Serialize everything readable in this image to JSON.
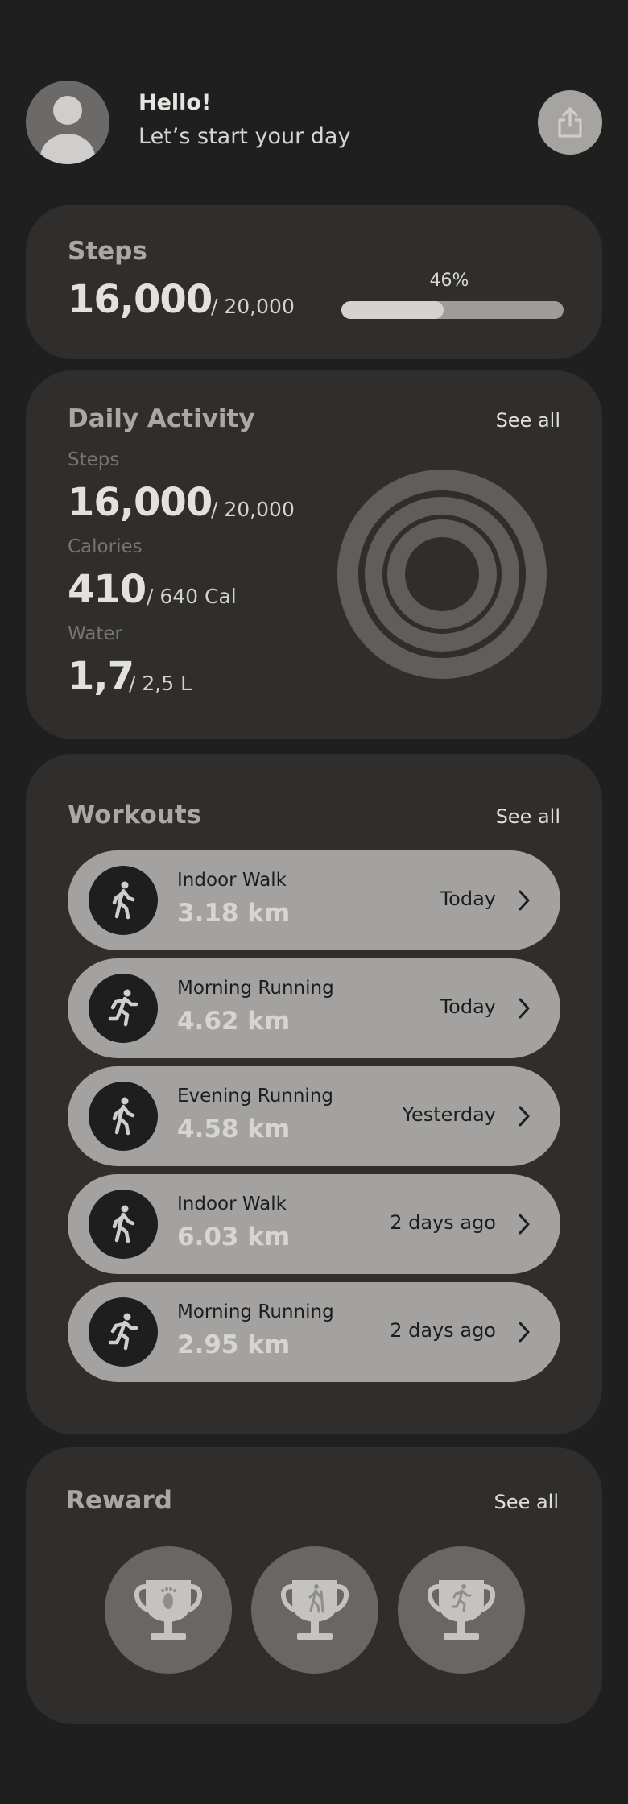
{
  "header": {
    "greeting": "Hello!",
    "subtitle": "Let’s start your day",
    "avatar_icon": "user-avatar-icon",
    "share_icon": "share-icon"
  },
  "steps": {
    "title": "Steps",
    "value": "16,000",
    "goal": "/ 20,000",
    "progress_label": "46%",
    "progress": 0.46
  },
  "activity": {
    "title": "Daily Activity",
    "see_all": "See all",
    "metrics": [
      {
        "label": "Steps",
        "value": "16,000",
        "goal": "/ 20,000"
      },
      {
        "label": "Calories",
        "value": "410",
        "goal": "/ 640 Cal"
      },
      {
        "label": "Water",
        "value": "1,7",
        "goal": "/ 2,5 L"
      }
    ]
  },
  "workouts": {
    "title": "Workouts",
    "see_all": "See all",
    "items": [
      {
        "name": "Indoor Walk",
        "distance": "3.18 km",
        "when": "Today",
        "icon": "walking-icon"
      },
      {
        "name": "Morning Running",
        "distance": "4.62 km",
        "when": "Today",
        "icon": "running-icon"
      },
      {
        "name": "Evening Running",
        "distance": "4.58 km",
        "when": "Yesterday",
        "icon": "walking-icon"
      },
      {
        "name": "Indoor Walk",
        "distance": "6.03 km",
        "when": "2 days ago",
        "icon": "walking-icon"
      },
      {
        "name": "Morning Running",
        "distance": "2.95 km",
        "when": "2 days ago",
        "icon": "running-icon"
      }
    ]
  },
  "reward": {
    "title": "Reward",
    "see_all": "See all",
    "badges": [
      {
        "icon": "trophy-footprint-icon"
      },
      {
        "icon": "trophy-hiker-icon"
      },
      {
        "icon": "trophy-runner-icon"
      }
    ]
  },
  "colors": {
    "background": "#1f1f1f",
    "card": "#2f2e2d",
    "pill": "#a3a2a0",
    "ring": "#5f5e5d"
  }
}
